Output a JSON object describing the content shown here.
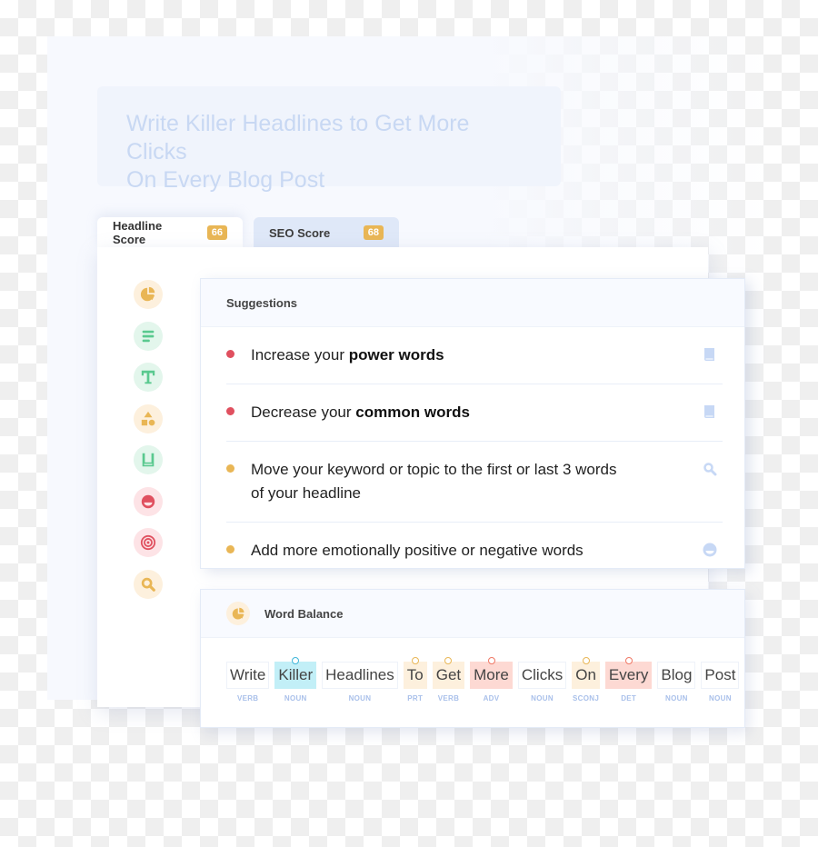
{
  "headline": {
    "line1": "Write Killer Headlines to Get More Clicks",
    "line2": "On Every Blog Post"
  },
  "tabs": [
    {
      "label": "Headline Score",
      "score": "66",
      "active": true
    },
    {
      "label": "SEO Score",
      "score": "68",
      "active": false
    }
  ],
  "sidebar": {
    "icons": [
      {
        "name": "word-balance-icon",
        "bg": "#fdf0dd",
        "fg": "#e9b655"
      },
      {
        "name": "length-icon",
        "bg": "#e3f6ec",
        "fg": "#5ac98f"
      },
      {
        "name": "type-icon",
        "bg": "#e3f6ec",
        "fg": "#5ac98f"
      },
      {
        "name": "shapes-icon",
        "bg": "#fdf0dd",
        "fg": "#e9b655"
      },
      {
        "name": "reading-icon",
        "bg": "#e3f6ec",
        "fg": "#5ac98f"
      },
      {
        "name": "sentiment-icon",
        "bg": "#fde3e6",
        "fg": "#e0505f"
      },
      {
        "name": "target-icon",
        "bg": "#fde3e6",
        "fg": "#e0505f"
      },
      {
        "name": "search-icon",
        "bg": "#fdf0dd",
        "fg": "#e9b655"
      }
    ]
  },
  "suggestions": {
    "title": "Suggestions",
    "items": [
      {
        "prefix": "Increase your ",
        "bold": "power words",
        "severity": "#e0505f",
        "action_icon": "book-icon"
      },
      {
        "prefix": "Decrease your ",
        "bold": "common words",
        "severity": "#e0505f",
        "action_icon": "book-icon"
      },
      {
        "prefix": "Move your keyword or topic to the first or last 3 words of your headline",
        "bold": "",
        "severity": "#e9b655",
        "action_icon": "search-icon"
      },
      {
        "prefix": "Add more emotionally positive or negative words",
        "bold": "",
        "severity": "#e9b655",
        "action_icon": "sentiment-icon"
      }
    ]
  },
  "word_balance": {
    "title": "Word Balance",
    "words": [
      {
        "word": "Write",
        "pos": "VERB",
        "bg": "#ffffff",
        "marker": ""
      },
      {
        "word": "Killer",
        "pos": "NOUN",
        "bg": "#c2eff7",
        "marker": "#3fb6d9"
      },
      {
        "word": "Headlines",
        "pos": "NOUN",
        "bg": "#ffffff",
        "marker": ""
      },
      {
        "word": "To",
        "pos": "PRT",
        "bg": "#fdf0dd",
        "marker": "#e9b655"
      },
      {
        "word": "Get",
        "pos": "VERB",
        "bg": "#fdf0dd",
        "marker": "#e9b655"
      },
      {
        "word": "More",
        "pos": "ADV",
        "bg": "#fdd9d3",
        "marker": "#ef7764"
      },
      {
        "word": "Clicks",
        "pos": "NOUN",
        "bg": "#ffffff",
        "marker": ""
      },
      {
        "word": "On",
        "pos": "SCONJ",
        "bg": "#fdf0dd",
        "marker": "#e9b655"
      },
      {
        "word": "Every",
        "pos": "DET",
        "bg": "#fdd9d3",
        "marker": "#ef7764"
      },
      {
        "word": "Blog",
        "pos": "NOUN",
        "bg": "#ffffff",
        "marker": ""
      },
      {
        "word": "Post",
        "pos": "NOUN",
        "bg": "#ffffff",
        "marker": ""
      }
    ]
  }
}
